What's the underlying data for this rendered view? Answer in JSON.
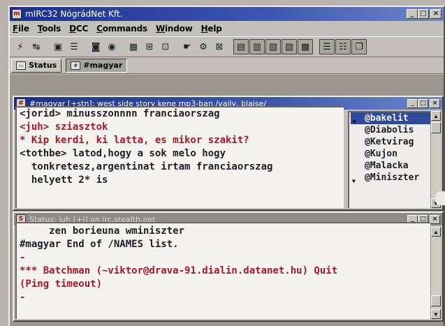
{
  "app": {
    "title": "mIRC32 NógrádNet Kft.",
    "icon_name": "mirc-app-icon"
  },
  "window_controls": {
    "minimize": "_",
    "maximize": "□",
    "close": "×"
  },
  "menu": [
    {
      "label": "File",
      "key": "F"
    },
    {
      "label": "Tools",
      "key": "T"
    },
    {
      "label": "DCC",
      "key": "D"
    },
    {
      "label": "Commands",
      "key": "C"
    },
    {
      "label": "Window",
      "key": "W"
    },
    {
      "label": "Help",
      "key": "H"
    }
  ],
  "toolbar": [
    {
      "name": "connect-icon",
      "glyph": "⚡"
    },
    {
      "name": "disconnect-icon",
      "glyph": "↹"
    },
    {
      "name": "sep"
    },
    {
      "name": "folder-icon",
      "glyph": "▣"
    },
    {
      "name": "options-icon",
      "glyph": "☰"
    },
    {
      "name": "sep"
    },
    {
      "name": "chat-icon",
      "glyph": "◙"
    },
    {
      "name": "notify-icon",
      "glyph": "◉"
    },
    {
      "name": "sep"
    },
    {
      "name": "channel-list-icon",
      "glyph": "▦"
    },
    {
      "name": "dcc-send-icon",
      "glyph": "⊞"
    },
    {
      "name": "dcc-chat-icon",
      "glyph": "⊡"
    },
    {
      "name": "sep"
    },
    {
      "name": "alias-icon",
      "glyph": "☛"
    },
    {
      "name": "remote-icon",
      "glyph": "⚙"
    },
    {
      "name": "finger-icon",
      "glyph": "⊠"
    },
    {
      "name": "sep"
    },
    {
      "name": "scripts-icon",
      "glyph": "▤",
      "boxed": true
    },
    {
      "name": "colors-icon",
      "glyph": "▥",
      "boxed": true
    },
    {
      "name": "url-icon",
      "glyph": "▧",
      "boxed": true
    },
    {
      "name": "address-book-icon",
      "glyph": "▨",
      "boxed": true
    },
    {
      "name": "timer-icon",
      "glyph": "▩",
      "boxed": true
    },
    {
      "name": "sep"
    },
    {
      "name": "tile-horizontal-icon",
      "glyph": "☰",
      "boxed": true
    },
    {
      "name": "tile-vertical-icon",
      "glyph": "☷",
      "boxed": true
    },
    {
      "name": "cascade-icon",
      "glyph": "❐",
      "boxed": true
    }
  ],
  "switchbar": {
    "status_label": "Status",
    "channel_label": "#magyar"
  },
  "channel_window": {
    "title": "#magyar [+stn]: west side story kene mp3-ban /vaily, blaise/",
    "lines": [
      {
        "text": "<jorid> minusszonnnn franciaorszag",
        "color": "dark"
      },
      {
        "text": "<juh> sziasztok",
        "color": "red"
      },
      {
        "text": "* Kip kerdi, ki latta, es mikor szakit?",
        "color": "red"
      },
      {
        "text": "<tothbe> latod,hogy a sok melo hogy",
        "color": "dark"
      },
      {
        "text": "  tonkretesz,argentinat irtam franciaorszag",
        "color": "dark"
      },
      {
        "text": "  helyett 2* is",
        "color": "dark"
      }
    ],
    "nicks": [
      "@bakelit",
      "@Diabolis",
      "@Ketvirag",
      "@Kujon",
      "@Malacka",
      "@Miniszter"
    ],
    "selected_nick": "@bakelit"
  },
  "status_window": {
    "title": "Status: juh [+i] on irc.stealth.net",
    "lines": [
      {
        "text": "     zen borieuna wminiszter",
        "color": "dark"
      },
      {
        "text": "#magyar End of /NAMES list.",
        "color": "dark"
      },
      {
        "text": "-",
        "color": "red"
      },
      {
        "text": "*** Batchman (~viktor@drava-91.dialin.datanet.hu) Quit",
        "color": "red"
      },
      {
        "text": "(Ping timeout)",
        "color": "red"
      },
      {
        "text": "-",
        "color": "red"
      }
    ]
  },
  "colors": {
    "title_active": "#1c2f8a",
    "text_dark": "#1e1f22",
    "text_red": "#a5182a",
    "nick_selected_bg": "#2f4a9c"
  }
}
